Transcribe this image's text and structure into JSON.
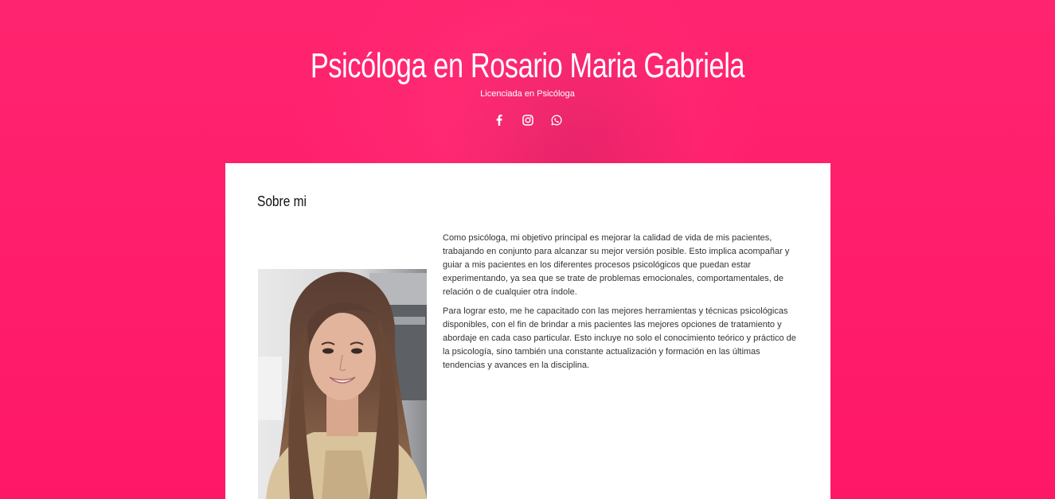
{
  "header": {
    "title": "Psicóloga en Rosario Maria Gabriela",
    "subtitle": "Licenciada en Psicóloga",
    "social": [
      {
        "name": "facebook-icon"
      },
      {
        "name": "instagram-icon"
      },
      {
        "name": "whatsapp-icon"
      }
    ]
  },
  "about": {
    "title": "Sobre mi",
    "paragraphs": [
      "Como psicóloga, mi objetivo principal es mejorar la calidad de vida de mis pacientes, trabajando en conjunto para alcanzar su mejor versión posible. Esto implica acompañar y guiar a mis pacientes en los diferentes procesos psicológicos que puedan estar experimentando, ya sea que se trate de problemas emocionales, comportamentales, de relación o de cualquier otra índole.",
      "Para lograr esto, me he capacitado con las mejores herramientas y técnicas psicológicas disponibles, con el fin de brindar a mis pacientes las mejores opciones de tratamiento y abordaje en cada caso particular. Esto incluye no solo el conocimiento teórico y práctico de la psicología, sino también una constante actualización y formación en las últimas tendencias y avances en la disciplina."
    ]
  },
  "colors": {
    "background": "#ff1f6d",
    "card": "#ffffff",
    "text": "#333333"
  }
}
